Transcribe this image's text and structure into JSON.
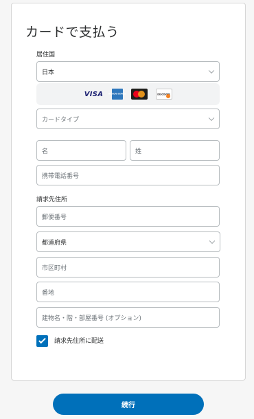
{
  "title": "カードで支払う",
  "country": {
    "label": "居住国",
    "value": "日本"
  },
  "card_logos": {
    "visa": "VISA",
    "amex": "AMERICAN EXPRESS",
    "discover": "DISCOVER"
  },
  "card_type": {
    "placeholder": "カードタイプ"
  },
  "first_name": {
    "placeholder": "名"
  },
  "last_name": {
    "placeholder": "姓"
  },
  "mobile": {
    "placeholder": "携帯電話番号"
  },
  "billing": {
    "label": "請求先住所",
    "postal": "郵便番号",
    "prefecture": "都道府県",
    "city": "市区町村",
    "street": "番地",
    "building": "建物名・階・部屋番号 (オプション)"
  },
  "ship_to_billing": {
    "label": "請求先住所に配送",
    "checked": true
  },
  "continue_label": "続行",
  "colors": {
    "accent": "#0070ba",
    "border": "#b7bcbf",
    "text": "#2c2e2f"
  }
}
